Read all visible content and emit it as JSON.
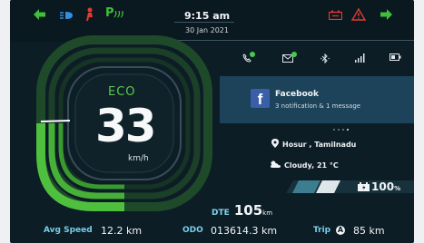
{
  "indicators": {
    "left_turn": "left-arrow-icon",
    "high_beam": "high-beam-icon",
    "side_stand": "side-stand-icon",
    "parking": "P",
    "battery_warning": "battery-warning-icon",
    "hazard": "hazard-icon",
    "right_turn": "right-arrow-icon",
    "green": "#3fbf3a",
    "red": "#e33a2e",
    "blue": "#2f8fe0"
  },
  "header": {
    "time": "9:15 am",
    "date": "30 Jan 2021"
  },
  "status_icons": [
    "call-icon",
    "message-icon",
    "bluetooth-icon",
    "signal-icon",
    "phone-battery-icon"
  ],
  "dashboard": {
    "mode": "ECO",
    "speed": "33",
    "speed_unit": "km/h"
  },
  "notification": {
    "app_icon": "f",
    "title": "Facebook",
    "subtitle": "3 notification & 1 message",
    "pages": 4,
    "active_page": 3
  },
  "location": {
    "text": "Hosur , Tamilnadu"
  },
  "weather": {
    "text": "Cloudy, 21 °C"
  },
  "battery": {
    "percent": "100",
    "percent_sign": "%",
    "level": 1.0
  },
  "range": {
    "label": "DTE",
    "value": "105",
    "unit": "km"
  },
  "footer": {
    "avg_speed_label": "Avg Speed",
    "avg_speed_value": "12.2 km",
    "odo_label": "ODO",
    "odo_value": "013614.3 km",
    "trip_label": "Trip",
    "trip_badge": "A",
    "trip_value": "85 km"
  }
}
